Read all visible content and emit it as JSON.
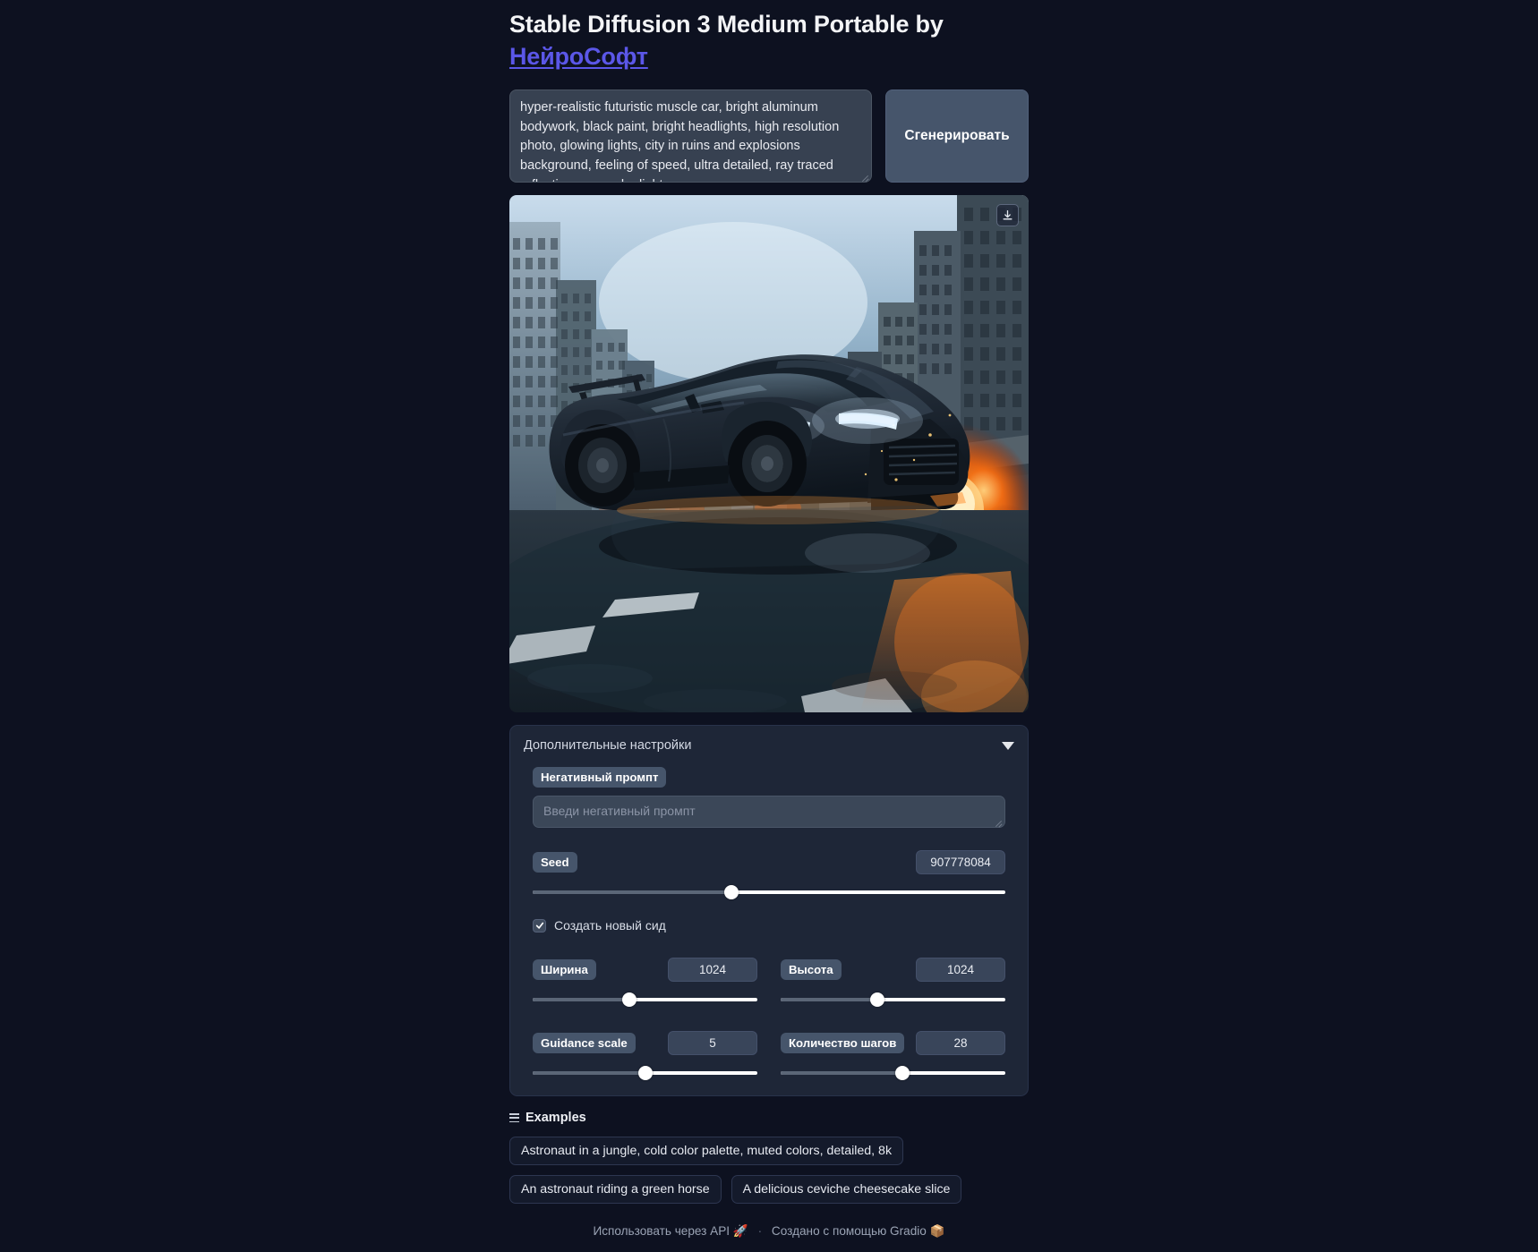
{
  "header": {
    "title_main": "Stable Diffusion 3 Medium Portable by",
    "title_link": "НейроСофт"
  },
  "prompt": {
    "value": "hyper-realistic futuristic muscle car, bright aluminum bodywork, black paint, bright headlights, high resolution photo, glowing lights, city in ruins and explosions background, feeling of speed, ultra detailed, ray traced reflections, specular lights",
    "generate_label": "Сгенерировать"
  },
  "result": {
    "download_icon": "download-icon"
  },
  "accordion": {
    "title": "Дополнительные настройки",
    "chevron_icon": "chevron-down-icon",
    "negative_prompt": {
      "label": "Негативный промпт",
      "value": "",
      "placeholder": "Введи негативный промпт"
    },
    "seed": {
      "label": "Seed",
      "value": "907778084",
      "slider_percent": 42
    },
    "randomize": {
      "label": "Создать новый сид",
      "checked": true
    },
    "width": {
      "label": "Ширина",
      "value": "1024",
      "slider_percent": 43
    },
    "height": {
      "label": "Высота",
      "value": "1024",
      "slider_percent": 43
    },
    "guidance": {
      "label": "Guidance scale",
      "value": "5",
      "slider_percent": 50
    },
    "steps": {
      "label": "Количество шагов",
      "value": "28",
      "slider_percent": 54
    }
  },
  "examples": {
    "title": "Examples",
    "list_icon": "list-icon",
    "rows": [
      [
        "Astronaut in a jungle, cold color palette, muted colors, detailed, 8k"
      ],
      [
        "An astronaut riding a green horse",
        "A delicious ceviche cheesecake slice"
      ]
    ]
  },
  "footer": {
    "api_label": "Использовать через API",
    "api_icon": "rocket-icon",
    "separator": "·",
    "built_label": "Создано с помощью Gradio",
    "gradio_icon": "package-icon"
  },
  "colors": {
    "background": "#0d1120",
    "panel": "#1e2637",
    "accent": "#5b57e8",
    "button": "#46556b",
    "pill": "#46556b"
  }
}
